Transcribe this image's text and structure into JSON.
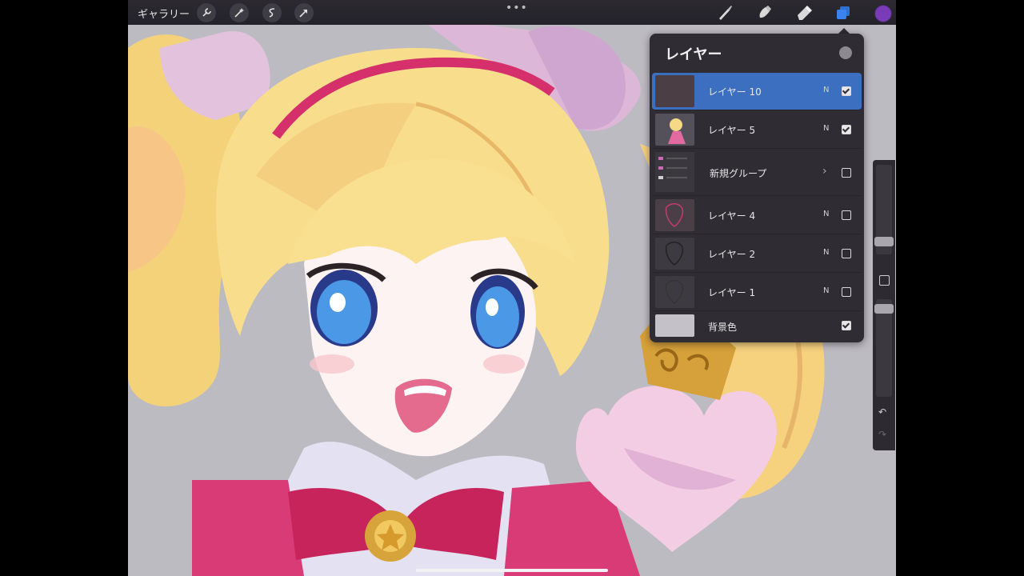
{
  "topbar": {
    "gallery_label": "ギャラリー",
    "more_label": "•••",
    "left_icons": [
      "wrench-icon",
      "magic-wand-icon",
      "selection-icon",
      "transform-arrow-icon"
    ],
    "right_tools": [
      "brush-icon",
      "smudge-icon",
      "eraser-icon",
      "layers-icon"
    ],
    "active_color": "#7a3bb8"
  },
  "layers_panel": {
    "title": "レイヤー",
    "layers": [
      {
        "name": "レイヤー 10",
        "mode": "N",
        "visible": true,
        "selected": true
      },
      {
        "name": "レイヤー 5",
        "mode": "N",
        "visible": true,
        "selected": false
      },
      {
        "name": "新規グループ",
        "mode": "",
        "visible": false,
        "selected": false,
        "group": true
      },
      {
        "name": "レイヤー 4",
        "mode": "N",
        "visible": false,
        "selected": false
      },
      {
        "name": "レイヤー 2",
        "mode": "N",
        "visible": false,
        "selected": false
      },
      {
        "name": "レイヤー 1",
        "mode": "N",
        "visible": false,
        "selected": false
      },
      {
        "name": "背景色",
        "mode": "",
        "visible": true,
        "selected": false,
        "background": true
      }
    ]
  },
  "sidebar": {
    "undo_icon": "undo-icon",
    "redo_icon": "redo-icon"
  },
  "colors": {
    "accent": "#3c6fc0",
    "panel": "#2f2d33",
    "canvas_bg": "#b9b7bd"
  }
}
